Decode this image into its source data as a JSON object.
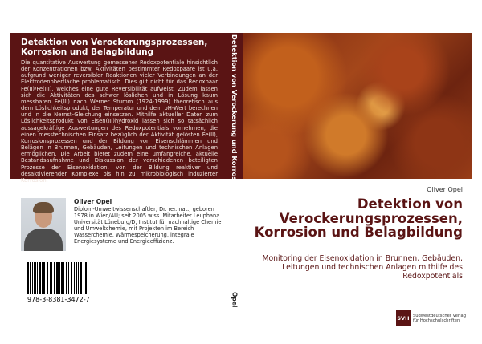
{
  "back": {
    "title": "Detektion von Verockerungsprozessen, Korrosion und Belagbildung",
    "blurb": "Die quantitative Auswertung gemessener Redoxpotentiale hinsichtlich der Konzentrationen bzw. Aktivitäten bestimmter Redoxpaare ist u.a. aufgrund weniger reversibler Reaktionen vieler Verbindungen an der Elektrodenoberfläche problematisch. Dies gilt nicht für das Redoxpaar Fe(II)/Fe(III), welches eine gute Reversibilität aufweist. Zudem lassen sich die Aktivitäten des schwer löslichen und in Lösung kaum messbaren Fe(III) nach Werner Stumm (1924-1999) theoretisch aus dem Löslichkeitsprodukt, der Temperatur und dem pH-Wert berechnen und in die Nernst-Gleichung einsetzen. Mithilfe aktueller Daten zum Löslichkeitsprodukt von Eisen(III)hydroxid lassen sich so tatsächlich aussagekräftige Auswertungen des Redoxpotentials vornehmen, die einen messtechnischen Einsatz bezüglich der Aktivität gelösten Fe(II), Korrosionsprozessen und der Bildung von Eisenschlämmen und Belägen in Brunnen, Gebäuden, Leitungen und technischen Anlagen ermöglichen. Die Arbeit bietet zudem eine umfangreiche, aktuelle Bestandsaufnahme und Diskussion der verschiedenen beteiligten Prozesse der Eisenoxidation, von der Bildung reaktiver und desaktivierender Komplexe bis hin zu mikrobiologisch induzierter Korrosion.",
    "author_name": "Oliver Opel",
    "author_bio": "Diplom-Umweltwissenschaftler, Dr. rer. nat.; geboren 1978 in Wien/AU; seit 2005 wiss. Mitarbeiter Leuphana Universität Lüneburg/D, Institut für nachhaltige Chemie und Umweltchemie, mit Projekten im Bereich Wasserchemie, Wärmespeicherung, integrale Energiesysteme und Energieeffizienz.",
    "isbn": "978-3-8381-3472-7"
  },
  "spine": {
    "title": "Detektion von Verockerung und Korrosion",
    "author": "Opel"
  },
  "front": {
    "author": "Oliver Opel",
    "title": "Detektion von Verockerungsprozessen, Korrosion und Belagbildung",
    "subtitle": "Monitoring der Eisenoxidation in Brunnen, Gebäuden, Leitungen und technischen Anlagen mithilfe des Redoxpotentials",
    "publisher_logo": "SVH",
    "publisher_line1": "Südwestdeutscher Verlag",
    "publisher_line2": "für Hochschulschriften"
  },
  "colors": {
    "accent": "#5a1414"
  }
}
